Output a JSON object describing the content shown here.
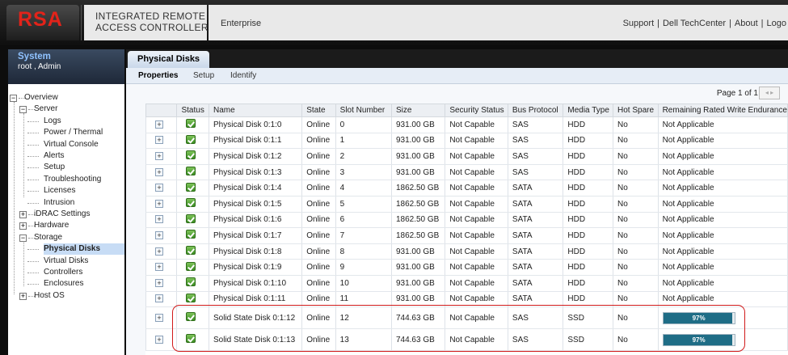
{
  "header": {
    "logo": "RSA",
    "title_line1": "INTEGRATED REMOTE",
    "title_line2": "ACCESS CONTROLLER",
    "edition": "Enterprise",
    "links": [
      "Support",
      "Dell TechCenter",
      "About",
      "Logo"
    ]
  },
  "sidebar": {
    "system_title": "System",
    "user": "root , Admin",
    "tree": [
      {
        "label": "Overview",
        "level": 0,
        "toggle": "-"
      },
      {
        "label": "Server",
        "level": 1,
        "toggle": "-"
      },
      {
        "label": "Logs",
        "level": 2
      },
      {
        "label": "Power / Thermal",
        "level": 2
      },
      {
        "label": "Virtual Console",
        "level": 2
      },
      {
        "label": "Alerts",
        "level": 2
      },
      {
        "label": "Setup",
        "level": 2
      },
      {
        "label": "Troubleshooting",
        "level": 2
      },
      {
        "label": "Licenses",
        "level": 2
      },
      {
        "label": "Intrusion",
        "level": 2
      },
      {
        "label": "iDRAC Settings",
        "level": 1,
        "toggle": "+"
      },
      {
        "label": "Hardware",
        "level": 1,
        "toggle": "+"
      },
      {
        "label": "Storage",
        "level": 1,
        "toggle": "-"
      },
      {
        "label": "Physical Disks",
        "level": 2,
        "selected": true
      },
      {
        "label": "Virtual Disks",
        "level": 2
      },
      {
        "label": "Controllers",
        "level": 2
      },
      {
        "label": "Enclosures",
        "level": 2
      },
      {
        "label": "Host OS",
        "level": 1,
        "toggle": "+"
      }
    ]
  },
  "main": {
    "tab": "Physical Disks",
    "subtabs": [
      "Properties",
      "Setup",
      "Identify"
    ],
    "pager": "Page 1 of 1",
    "pager_arrows": "◂ ▸",
    "columns": [
      "",
      "Status",
      "Name",
      "State",
      "Slot Number",
      "Size",
      "Security Status",
      "Bus Protocol",
      "Media Type",
      "Hot Spare",
      "Remaining Rated Write Endurance"
    ],
    "rows": [
      {
        "name": "Physical Disk 0:1:0",
        "state": "Online",
        "slot": "0",
        "size": "931.00 GB",
        "security": "Not Capable",
        "bus": "SAS",
        "media": "HDD",
        "hotspare": "No",
        "endurance": "Not Applicable"
      },
      {
        "name": "Physical Disk 0:1:1",
        "state": "Online",
        "slot": "1",
        "size": "931.00 GB",
        "security": "Not Capable",
        "bus": "SAS",
        "media": "HDD",
        "hotspare": "No",
        "endurance": "Not Applicable"
      },
      {
        "name": "Physical Disk 0:1:2",
        "state": "Online",
        "slot": "2",
        "size": "931.00 GB",
        "security": "Not Capable",
        "bus": "SAS",
        "media": "HDD",
        "hotspare": "No",
        "endurance": "Not Applicable"
      },
      {
        "name": "Physical Disk 0:1:3",
        "state": "Online",
        "slot": "3",
        "size": "931.00 GB",
        "security": "Not Capable",
        "bus": "SAS",
        "media": "HDD",
        "hotspare": "No",
        "endurance": "Not Applicable"
      },
      {
        "name": "Physical Disk 0:1:4",
        "state": "Online",
        "slot": "4",
        "size": "1862.50 GB",
        "security": "Not Capable",
        "bus": "SATA",
        "media": "HDD",
        "hotspare": "No",
        "endurance": "Not Applicable"
      },
      {
        "name": "Physical Disk 0:1:5",
        "state": "Online",
        "slot": "5",
        "size": "1862.50 GB",
        "security": "Not Capable",
        "bus": "SATA",
        "media": "HDD",
        "hotspare": "No",
        "endurance": "Not Applicable"
      },
      {
        "name": "Physical Disk 0:1:6",
        "state": "Online",
        "slot": "6",
        "size": "1862.50 GB",
        "security": "Not Capable",
        "bus": "SATA",
        "media": "HDD",
        "hotspare": "No",
        "endurance": "Not Applicable"
      },
      {
        "name": "Physical Disk 0:1:7",
        "state": "Online",
        "slot": "7",
        "size": "1862.50 GB",
        "security": "Not Capable",
        "bus": "SATA",
        "media": "HDD",
        "hotspare": "No",
        "endurance": "Not Applicable"
      },
      {
        "name": "Physical Disk 0:1:8",
        "state": "Online",
        "slot": "8",
        "size": "931.00 GB",
        "security": "Not Capable",
        "bus": "SATA",
        "media": "HDD",
        "hotspare": "No",
        "endurance": "Not Applicable"
      },
      {
        "name": "Physical Disk 0:1:9",
        "state": "Online",
        "slot": "9",
        "size": "931.00 GB",
        "security": "Not Capable",
        "bus": "SATA",
        "media": "HDD",
        "hotspare": "No",
        "endurance": "Not Applicable"
      },
      {
        "name": "Physical Disk 0:1:10",
        "state": "Online",
        "slot": "10",
        "size": "931.00 GB",
        "security": "Not Capable",
        "bus": "SATA",
        "media": "HDD",
        "hotspare": "No",
        "endurance": "Not Applicable"
      },
      {
        "name": "Physical Disk 0:1:11",
        "state": "Online",
        "slot": "11",
        "size": "931.00 GB",
        "security": "Not Capable",
        "bus": "SATA",
        "media": "HDD",
        "hotspare": "No",
        "endurance": "Not Applicable"
      },
      {
        "name": "Solid State Disk 0:1:12",
        "state": "Online",
        "slot": "12",
        "size": "744.63 GB",
        "security": "Not Capable",
        "bus": "SAS",
        "media": "SSD",
        "hotspare": "No",
        "endurance": "97%",
        "endurance_fraction": 0.97
      },
      {
        "name": "Solid State Disk 0:1:13",
        "state": "Online",
        "slot": "13",
        "size": "744.63 GB",
        "security": "Not Capable",
        "bus": "SAS",
        "media": "SSD",
        "hotspare": "No",
        "endurance": "97%",
        "endurance_fraction": 0.97
      }
    ]
  },
  "icons": {
    "expand": "plus-box-icon",
    "status": "green-check-icon"
  },
  "colors": {
    "logo_red": "#e2231a",
    "bar_fill": "#1f6d86",
    "highlight": "#d11a1a",
    "system_blue": "#8fc2ff"
  }
}
